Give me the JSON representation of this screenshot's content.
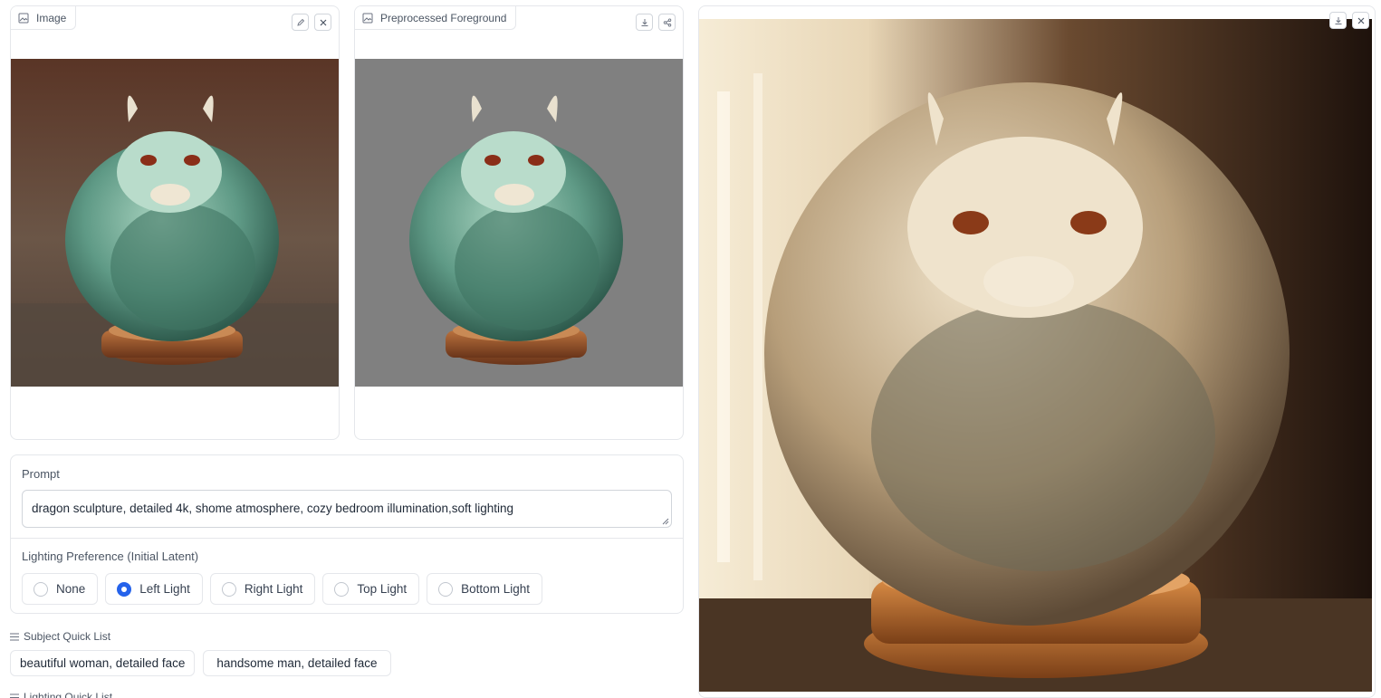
{
  "input_panel": {
    "label": "Image",
    "icon": "image-icon",
    "tools": [
      "edit-icon",
      "close-icon"
    ]
  },
  "foreground_panel": {
    "label": "Preprocessed Foreground",
    "icon": "image-icon",
    "tools": [
      "download-icon",
      "share-icon"
    ]
  },
  "prompt": {
    "label": "Prompt",
    "value": "dragon sculpture, detailed 4k, shome atmosphere, cozy bedroom illumination,soft lighting"
  },
  "lighting": {
    "label": "Lighting Preference (Initial Latent)",
    "selected": "Left Light",
    "options": [
      "None",
      "Left Light",
      "Right Light",
      "Top Light",
      "Bottom Light"
    ]
  },
  "subject_quick_list": {
    "label": "Subject Quick List",
    "items": [
      "beautiful woman, detailed face",
      "handsome man, detailed face"
    ]
  },
  "lighting_quick_list": {
    "label": "Lighting Quick List"
  },
  "result_panel": {
    "tools": [
      "download-icon",
      "close-icon"
    ]
  },
  "colors": {
    "accent": "#2563eb",
    "border": "#e5e7eb",
    "jade_dragon": "#5f9a86",
    "ivory_dragon": "#d8c3a0",
    "wood_base": "#8a4a22",
    "foreground_bg": "#808080"
  }
}
